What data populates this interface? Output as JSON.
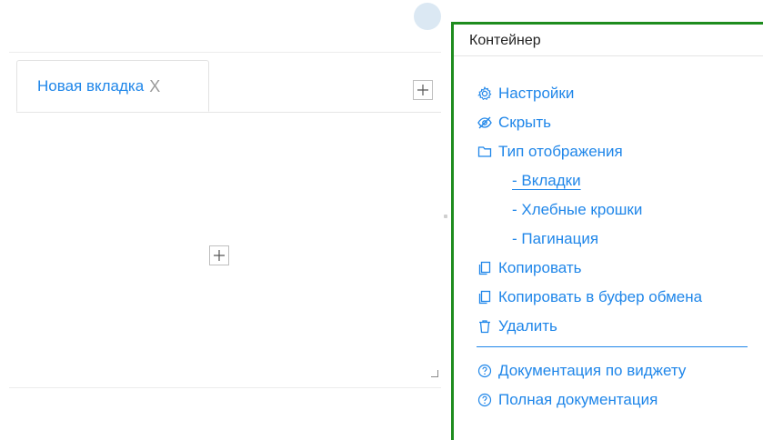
{
  "widget": {
    "tab": {
      "label": "Новая вкладка",
      "close_glyph": "X"
    },
    "tab_add_icon": "plus-icon",
    "content_add_icon": "plus-icon"
  },
  "menu": {
    "title": "Контейнер",
    "items": [
      {
        "label": "Настройки",
        "icon": "gear-icon"
      },
      {
        "label": "Скрыть",
        "icon": "eye-off-icon"
      },
      {
        "label": "Тип отображения",
        "icon": "folder-icon"
      }
    ],
    "display_types": [
      {
        "label": "- Вкладки",
        "active": true
      },
      {
        "label": "- Хлебные крошки",
        "active": false
      },
      {
        "label": "- Пагинация",
        "active": false
      }
    ],
    "actions": [
      {
        "label": "Копировать",
        "icon": "copy-icon"
      },
      {
        "label": "Копировать в буфер обмена",
        "icon": "copy-icon"
      },
      {
        "label": "Удалить",
        "icon": "trash-icon"
      }
    ],
    "docs": [
      {
        "label": "Документация по виджету",
        "icon": "help-icon"
      },
      {
        "label": "Полная документация",
        "icon": "help-icon"
      }
    ],
    "accent_color": "#1f86e9",
    "border_color": "#1e8c1e"
  }
}
